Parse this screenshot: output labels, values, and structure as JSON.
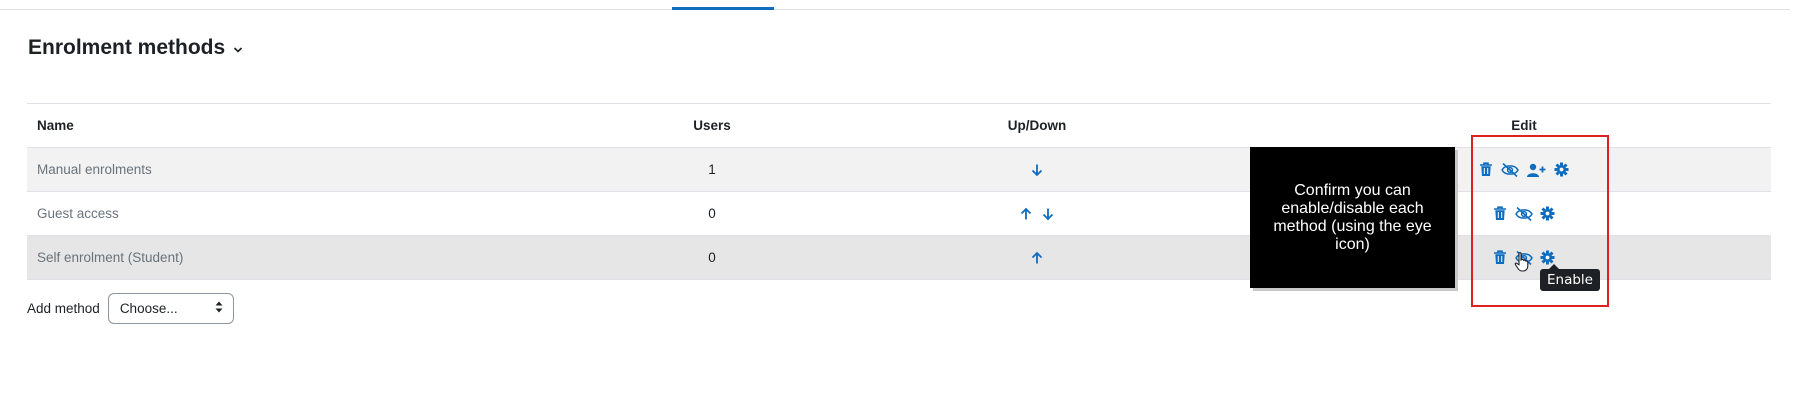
{
  "page": {
    "heading": "Enrolment methods"
  },
  "table": {
    "headers": {
      "name": "Name",
      "users": "Users",
      "updown": "Up/Down",
      "edit": "Edit"
    },
    "rows": [
      {
        "name": "Manual enrolments",
        "users": "1",
        "updown": [
          "down"
        ],
        "edit": [
          "trash-icon",
          "eye-slash-icon",
          "user-plus-icon",
          "gear-icon"
        ]
      },
      {
        "name": "Guest access",
        "users": "0",
        "updown": [
          "up",
          "down"
        ],
        "edit": [
          "trash-icon",
          "eye-slash-icon",
          "gear-icon"
        ]
      },
      {
        "name": "Self enrolment (Student)",
        "users": "0",
        "updown": [
          "up"
        ],
        "edit": [
          "trash-icon",
          "eye-slash-icon",
          "gear-icon"
        ]
      }
    ]
  },
  "add_method": {
    "label": "Add method",
    "selected": "Choose..."
  },
  "annotation": {
    "callout": "Confirm you can enable/disable each method (using the eye icon)",
    "tooltip": "Enable"
  },
  "colors": {
    "icon": "#0f6cbf",
    "annotation_border": "#e02020",
    "callout_bg": "#000000"
  }
}
